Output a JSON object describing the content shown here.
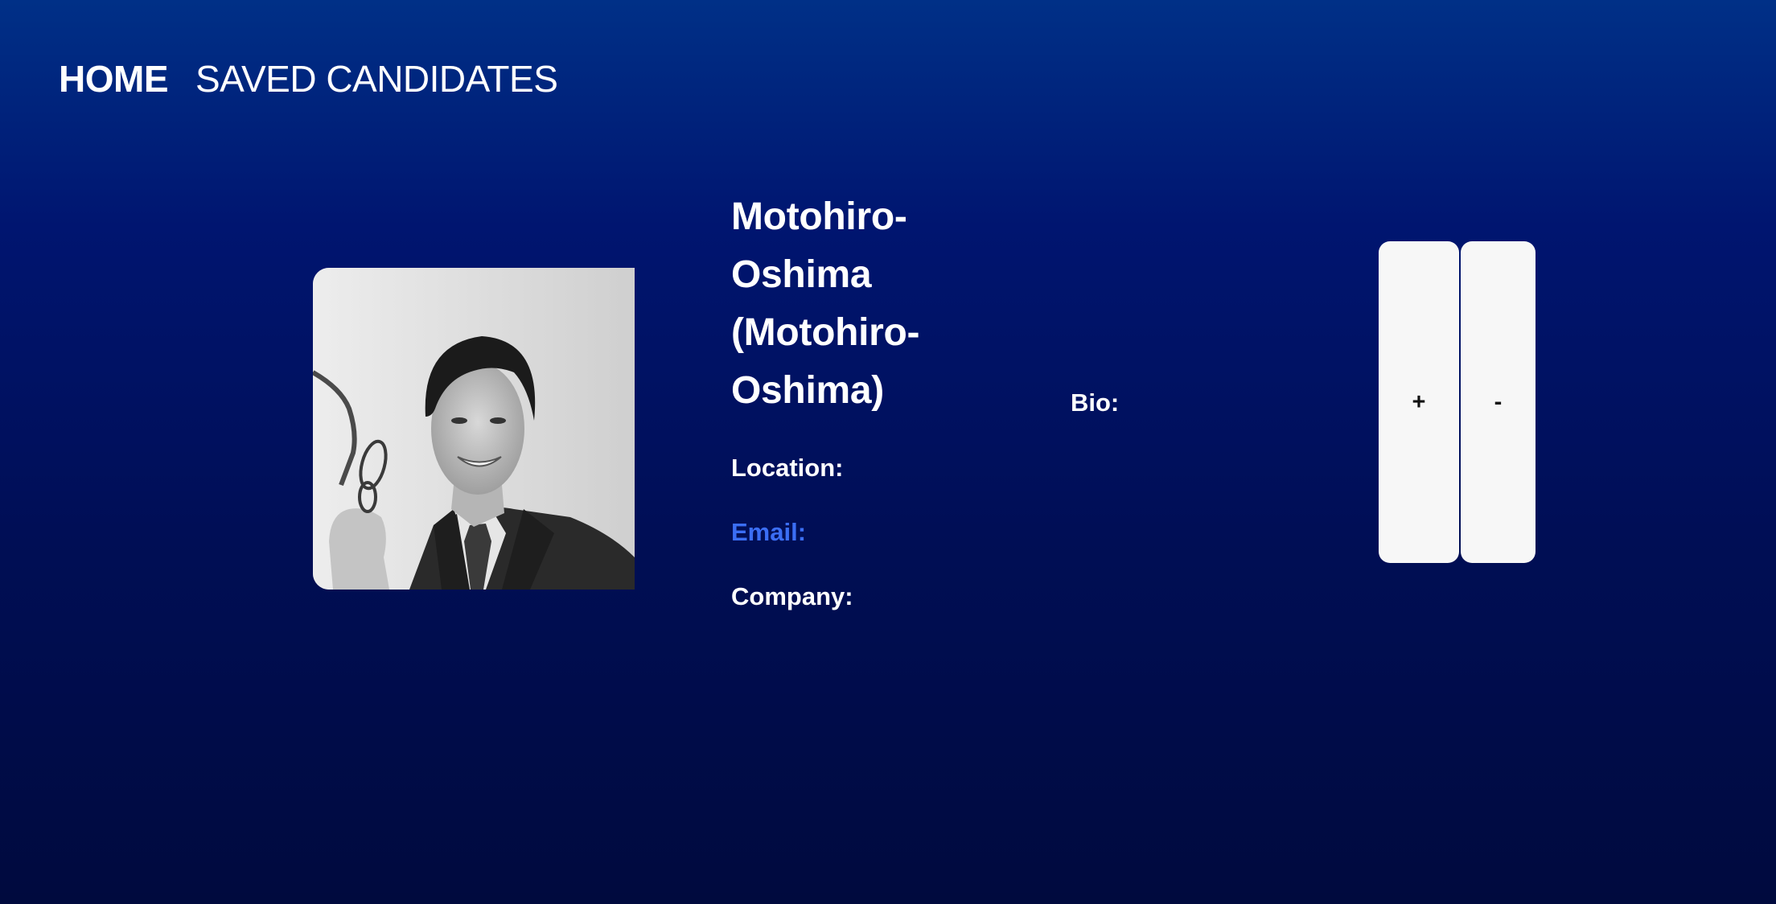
{
  "nav": {
    "home_label": "HOME",
    "saved_label": "SAVED CANDIDATES"
  },
  "candidate": {
    "name": "Motohiro-Oshima (Motohiro-Oshima)",
    "avatar_icon": "candidate-avatar-photo",
    "location_label": "Location:",
    "email_label": "Email:",
    "company_label": "Company:",
    "bio_label": "Bio:"
  },
  "actions": {
    "add_label": "+",
    "remove_label": "-"
  },
  "colors": {
    "background_top": "#003087",
    "background_bottom": "#000a3e",
    "email_link": "#3b6ef5",
    "button_bg": "#f7f7f7"
  }
}
